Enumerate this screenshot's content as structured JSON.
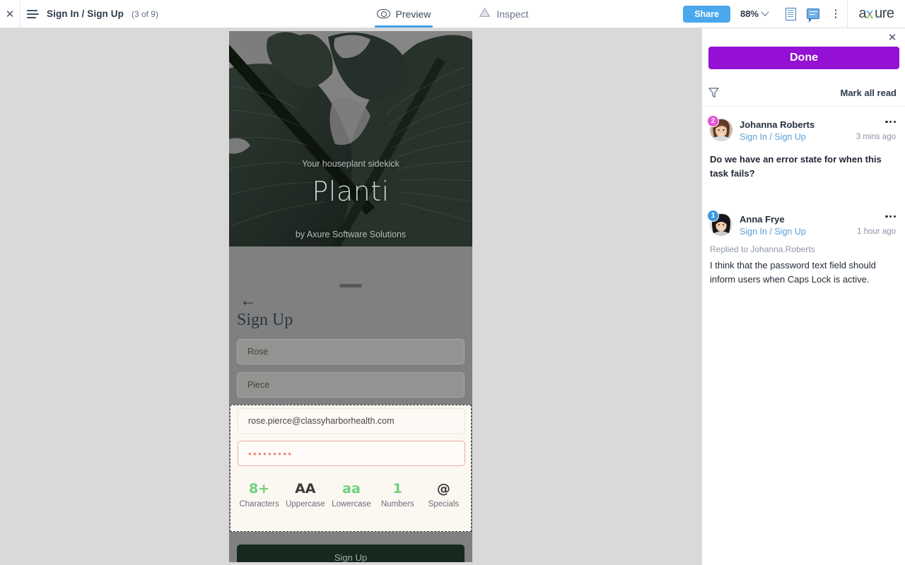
{
  "toolbar": {
    "close_icon": "close-icon",
    "menu_icon": "hamburger-icon",
    "page_title": "Sign In / Sign Up",
    "page_count": "(3 of 9)",
    "tabs": [
      {
        "label": "Preview",
        "icon": "eye-icon",
        "active": true
      },
      {
        "label": "Inspect",
        "icon": "inspect-icon",
        "active": false
      }
    ],
    "share_label": "Share",
    "zoom_level": "88%",
    "zoom_chevron": "chevron-down-icon",
    "notes_icon": "notes-panel-icon",
    "comments_icon": "comments-panel-icon",
    "more_icon": "kebab-menu-icon",
    "brand": "axure",
    "brand_colors": {
      "magenta": "#e02ea0",
      "cyan": "#19c3e8",
      "green": "#7ac943"
    },
    "accent_blue": "#4aa8ec"
  },
  "prototype": {
    "hero": {
      "title": "Planti",
      "subtitle_line1": "Your houseplant sidekick",
      "subtitle_line2": "by Axure Software Solutions"
    },
    "back_icon": "back-arrow-icon",
    "heading": "Sign Up",
    "fields": [
      {
        "name": "first-name",
        "value": "Rose"
      },
      {
        "name": "last-name",
        "value": "Piece"
      }
    ],
    "selected_group": {
      "email": {
        "value": "rose.pierce@classyharborhealth.com"
      },
      "password": {
        "value": "•••••••••",
        "state": "error",
        "border_color": "#f0a9a0"
      },
      "password_rules": [
        {
          "icon": "8+",
          "label": "Characters",
          "met": true
        },
        {
          "icon": "AA",
          "label": "Uppercase",
          "met": false
        },
        {
          "icon": "aa",
          "label": "Lowercase",
          "met": true
        },
        {
          "icon": "1",
          "label": "Numbers",
          "met": true
        },
        {
          "icon": "@",
          "label": "Specials",
          "met": false
        }
      ],
      "met_color": "#6ed07e",
      "unmet_color": "#3b3b3b"
    },
    "submit_label": "Sign Up",
    "submit_bg": "#16291d"
  },
  "comments_panel": {
    "close_icon": "close-icon",
    "done_label": "Done",
    "done_color": "#9310d4",
    "filter_icon": "filter-funnel-icon",
    "mark_all_read_label": "Mark all read",
    "comments": [
      {
        "badge": "2",
        "badge_color": "#e851d8",
        "author": "Johanna Roberts",
        "page_link": "Sign In / Sign Up",
        "time": "3 mins ago",
        "more_icon": "kebab-menu-icon",
        "reply_to": "",
        "body": "Do we have an error state for when this task fails?",
        "bold": true
      },
      {
        "badge": "1",
        "badge_color": "#3d96e0",
        "author": "Anna Frye",
        "page_link": "Sign In / Sign Up",
        "time": "1 hour ago",
        "more_icon": "kebab-menu-icon",
        "reply_to": "Replied to Johanna.Roberts",
        "body": "I think that the password text field should inform users when Caps Lock is active.",
        "bold": false
      }
    ]
  }
}
